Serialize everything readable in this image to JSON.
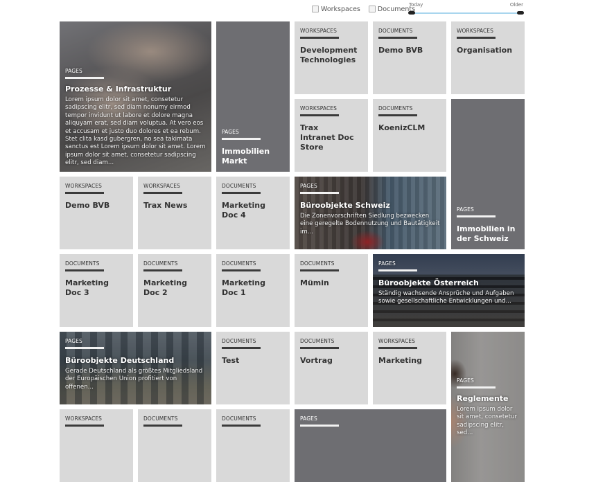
{
  "filters": {
    "workspaces_label": "Workspaces",
    "documents_label": "Documents",
    "workspaces_checked": false,
    "documents_checked": false
  },
  "time_slider": {
    "left_label": "Today",
    "right_label": "Older",
    "range_start": 0,
    "range_end": 1
  },
  "tiles": [
    {
      "category": "PAGES",
      "title": "Prozesse & Infrastruktur",
      "description": "Lorem ipsum dolor sit amet, consetetur sadipscing elitr, sed diam nonumy eirmod tempor invidunt ut labore et dolore magna aliquyam erat, sed diam voluptua. At vero eos et accusam et justo duo dolores et ea rebum. Stet clita kasd gubergren, no sea takimata sanctus est Lorem ipsum dolor sit amet. Lorem ipsum dolor sit amet, consetetur sadipscing elitr, sed diam...",
      "image": "hands-on-keyboard"
    },
    {
      "category": "PAGES",
      "title": "Immobilien Markt"
    },
    {
      "category": "WORKSPACES",
      "title": "Development Technologies"
    },
    {
      "category": "DOCUMENTS",
      "title": "Demo BVB"
    },
    {
      "category": "WORKSPACES",
      "title": "Organisation"
    },
    {
      "category": "WORKSPACES",
      "title": "Trax Intranet Doc Store"
    },
    {
      "category": "DOCUMENTS",
      "title": "KoenizCLM"
    },
    {
      "category": "PAGES",
      "title": "Immobilien in der Schweiz"
    },
    {
      "category": "WORKSPACES",
      "title": "Demo BVB"
    },
    {
      "category": "WORKSPACES",
      "title": "Trax News"
    },
    {
      "category": "DOCUMENTS",
      "title": "Marketing Doc 4"
    },
    {
      "category": "PAGES",
      "title": "Büroobjekte Schweiz",
      "description": "Die Zonenvorschriften Siedlung bezwecken eine geregelte Bodennutzung und Bautätigkeit im...",
      "image": "city-buildings"
    },
    {
      "category": "DOCUMENTS",
      "title": "Marketing Doc 3"
    },
    {
      "category": "DOCUMENTS",
      "title": "Marketing Doc 2"
    },
    {
      "category": "DOCUMENTS",
      "title": "Marketing Doc 1"
    },
    {
      "category": "DOCUMENTS",
      "title": "Mümin"
    },
    {
      "category": "PAGES",
      "title": "Büroobjekte Österreich",
      "description": "Ständig wachsende Ansprüche und Aufgaben sowie gesellschaftliche Entwicklungen und...",
      "image": "office-building"
    },
    {
      "category": "PAGES",
      "title": "Büroobjekte Deutschland",
      "description": "Gerade Deutschland als größtes Mitgliedsland der Europäischen Union profitiert von offenen...",
      "image": "skyline"
    },
    {
      "category": "DOCUMENTS",
      "title": "Test"
    },
    {
      "category": "DOCUMENTS",
      "title": "Vortrag"
    },
    {
      "category": "WORKSPACES",
      "title": "Marketing"
    },
    {
      "category": "PAGES",
      "title": "Reglemente",
      "description": "Lorem ipsum dolor sit amet, consetetur sadipscing elitr, sed...",
      "image": "smiling-man"
    },
    {
      "category": "WORKSPACES",
      "title": ""
    },
    {
      "category": "DOCUMENTS",
      "title": ""
    },
    {
      "category": "DOCUMENTS",
      "title": ""
    },
    {
      "category": "PAGES",
      "title": ""
    }
  ]
}
